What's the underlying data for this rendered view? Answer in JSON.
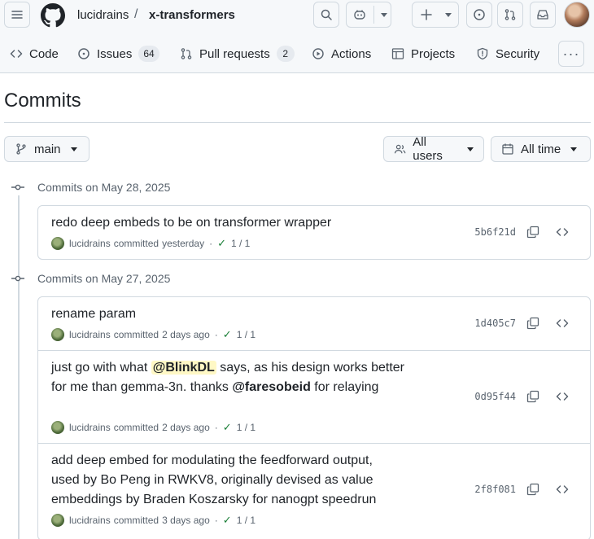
{
  "repo": {
    "owner": "lucidrains",
    "separator": "/",
    "name": "x-transformers"
  },
  "tabs": [
    {
      "label": "Code",
      "icon": "code-icon"
    },
    {
      "label": "Issues",
      "icon": "issue-opened-icon",
      "count": "64"
    },
    {
      "label": "Pull requests",
      "icon": "git-pull-request-icon",
      "count": "2"
    },
    {
      "label": "Actions",
      "icon": "play-icon"
    },
    {
      "label": "Projects",
      "icon": "table-icon"
    },
    {
      "label": "Security",
      "icon": "shield-icon"
    }
  ],
  "page": {
    "title": "Commits"
  },
  "filters": {
    "branch": "main",
    "users": "All users",
    "time": "All time"
  },
  "groups": [
    {
      "heading": "Commits on May 28, 2025",
      "commits": [
        {
          "message": "redo deep embeds to be on transformer wrapper",
          "author": "lucidrains",
          "action": "committed",
          "when": "yesterday",
          "checks": "1 / 1",
          "sha": "5b6f21d"
        }
      ]
    },
    {
      "heading": "Commits on May 27, 2025",
      "commits": [
        {
          "message": "rename param",
          "author": "lucidrains",
          "action": "committed",
          "when": "2 days ago",
          "checks": "1 / 1",
          "sha": "1d405c7"
        },
        {
          "message_parts": {
            "p1": "just go with what ",
            "m1": "@BlinkDL",
            "p2": " says, as his design works better for me than gemma-3n. thanks ",
            "m2": "@faresobeid",
            "p3": " for relaying"
          },
          "author": "lucidrains",
          "action": "committed",
          "when": "2 days ago",
          "checks": "1 / 1",
          "sha": "0d95f44"
        },
        {
          "message": "add deep embed for modulating the feedforward output, used by Bo Peng in RWKV8, originally devised as value embeddings by Braden Koszarsky for nanogpt speedrun",
          "author": "lucidrains",
          "action": "committed",
          "when": "3 days ago",
          "checks": "1 / 1",
          "sha": "2f8f081"
        }
      ]
    }
  ]
}
